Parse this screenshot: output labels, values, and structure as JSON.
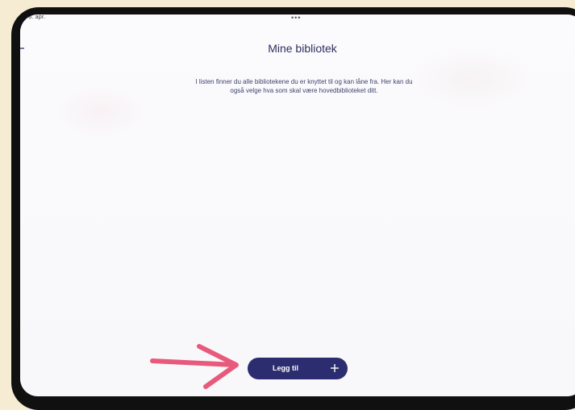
{
  "status_bar": {
    "time_date": "n. 8. apr.",
    "multitask_dots": "•••"
  },
  "header": {
    "back_icon": "back-arrow-icon",
    "title": "Mine bibliotek"
  },
  "intro": {
    "text": "I listen finner du alle bibliotekene du er knyttet til og kan låne fra. Her kan du også velge hva som skal være hovedbiblioteket ditt."
  },
  "actions": {
    "add_label": "Legg til",
    "add_icon": "plus-icon"
  },
  "annotation": {
    "arrow_icon": "pointer-arrow-icon",
    "arrow_color": "#e85a7c"
  },
  "colors": {
    "accent": "#2c2c70",
    "text": "#2e2f5f",
    "background": "#f6ebd3",
    "device": "#101010"
  }
}
